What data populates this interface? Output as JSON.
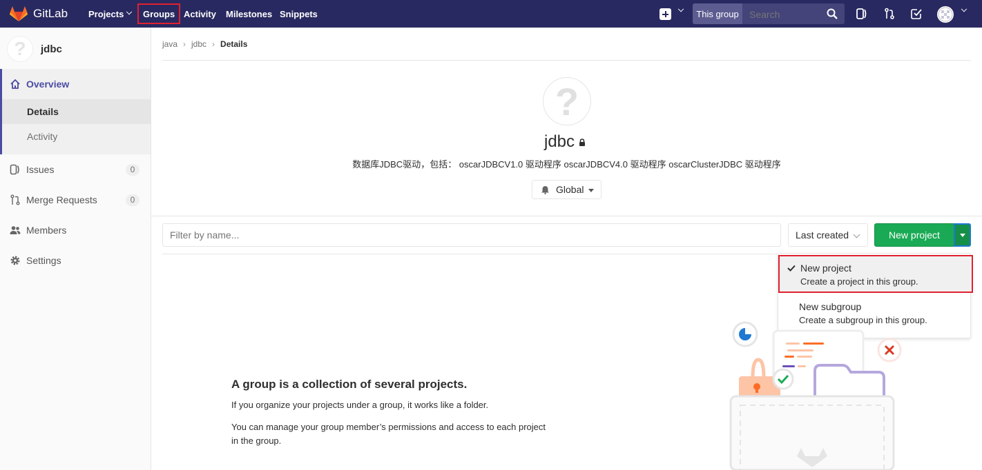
{
  "topbar": {
    "brand": "GitLab",
    "nav": {
      "projects": "Projects",
      "groups": "Groups",
      "activity": "Activity",
      "milestones": "Milestones",
      "snippets": "Snippets"
    },
    "search_scope": "This group",
    "search_placeholder": "Search"
  },
  "sidebar": {
    "group_name": "jdbc",
    "overview": "Overview",
    "details": "Details",
    "activity": "Activity",
    "issues": "Issues",
    "issues_count": "0",
    "merge_requests": "Merge Requests",
    "mr_count": "0",
    "members": "Members",
    "settings": "Settings"
  },
  "breadcrumb": {
    "a": "java",
    "b": "jdbc",
    "c": "Details"
  },
  "group": {
    "avatar_char": "?",
    "name": "jdbc",
    "description": "数据库JDBC驱动，包括： oscarJDBCV1.0 驱动程序 oscarJDBCV4.0 驱动程序 oscarClusterJDBC 驱动程序",
    "notification": "Global"
  },
  "toolbar": {
    "filter_placeholder": "Filter by name...",
    "sort": "Last created",
    "new_project": "New project"
  },
  "dropdown": {
    "item1_title": "New project",
    "item1_sub": "Create a project in this group.",
    "item2_title": "New subgroup",
    "item2_sub": "Create a subgroup in this group."
  },
  "empty": {
    "title": "A group is a collection of several projects.",
    "p1": "If you organize your projects under a group, it works like a folder.",
    "p2": "You can manage your group member’s permissions and access to each project in the group."
  },
  "colors": {
    "nav_bg": "#292961",
    "accent": "#4b4ba3",
    "green": "#1aaa55",
    "highlight": "#e1202f"
  }
}
